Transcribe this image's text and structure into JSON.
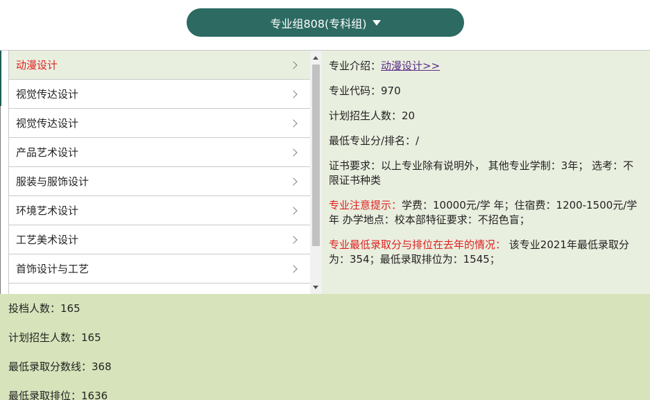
{
  "header": {
    "group_button_label": "专业组808(专科组)"
  },
  "majors": {
    "items": [
      {
        "label": "动漫设计",
        "active": true
      },
      {
        "label": "视觉传达设计",
        "active": false
      },
      {
        "label": "视觉传达设计",
        "active": false
      },
      {
        "label": "产品艺术设计",
        "active": false
      },
      {
        "label": "服装与服饰设计",
        "active": false
      },
      {
        "label": "环境艺术设计",
        "active": false
      },
      {
        "label": "工艺美术设计",
        "active": false
      },
      {
        "label": "首饰设计与工艺",
        "active": false
      },
      {
        "label": "",
        "active": false
      }
    ]
  },
  "detail": {
    "intro_label": "专业介绍：",
    "intro_link": "动漫设计>>",
    "code_line": "专业代码：970",
    "plan_line": "计划招生人数：20",
    "min_score_line": "最低专业分/排名：/",
    "cert_line": "证书要求：以上专业除有说明外， 其他专业学制：3年； 选考：不限证书种类",
    "notice_label": "专业注意提示：",
    "notice_text": "学费：10000元/学 年；住宿费：1200-1500元/学年 办学地点：校本部特征要求：不招色盲；",
    "history_label": "专业最低录取分与排位在去年的情况：",
    "history_text": " 该专业2021年最低录取分为：354；最低录取排位为：1545；"
  },
  "summary": {
    "submitted": "投档人数：165",
    "planned": "计划招生人数：165",
    "min_score": "最低录取分数线：368",
    "min_rank": "最低录取排位：1636"
  },
  "colors": {
    "button_bg": "#2c6a62",
    "active_text": "#e02020",
    "detail_bg": "#e9efdf",
    "summary_bg": "#d7e4bb"
  }
}
